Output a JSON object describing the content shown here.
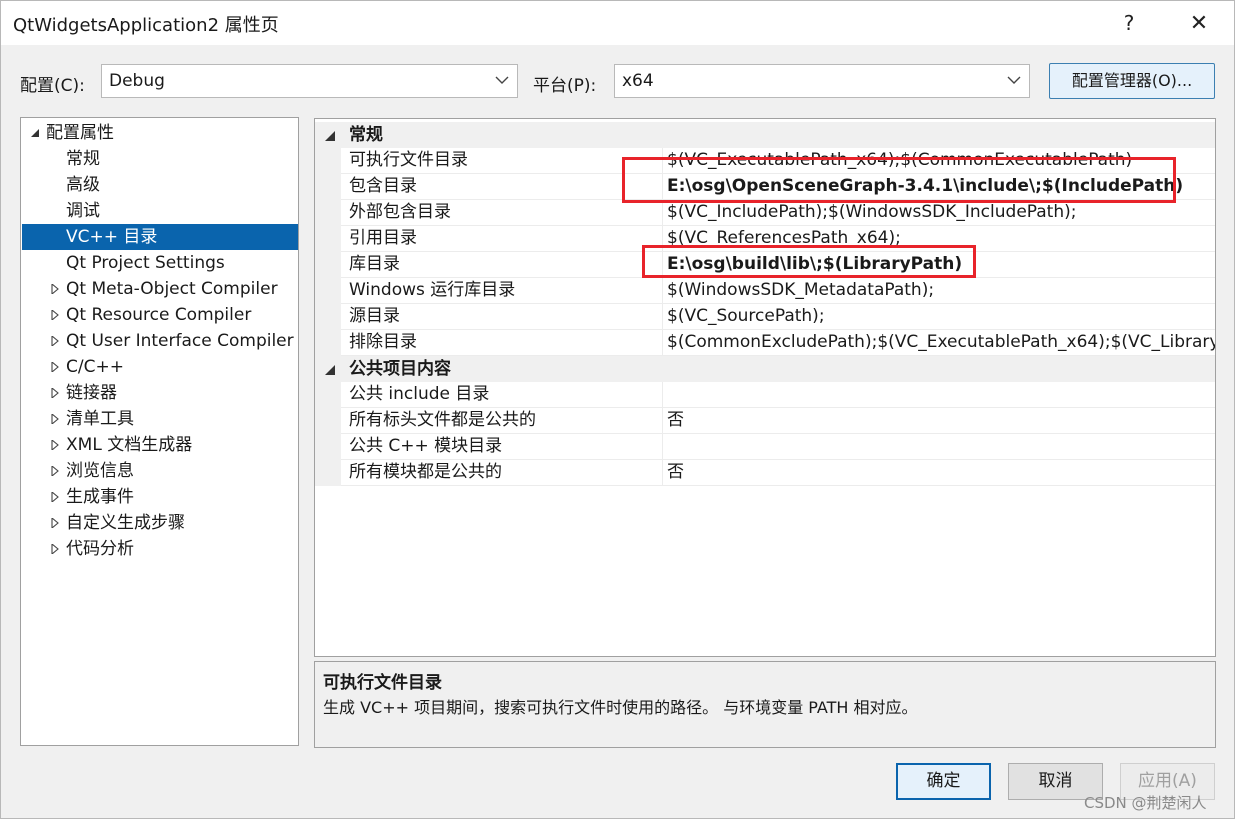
{
  "window": {
    "title": "QtWidgetsApplication2 属性页",
    "help_glyph": "?",
    "close_glyph": "✕"
  },
  "config": {
    "config_label": "配置(C):",
    "config_value": "Debug",
    "platform_label": "平台(P):",
    "platform_value": "x64",
    "manager_button": "配置管理器(O)..."
  },
  "tree": {
    "items": [
      {
        "label": "配置属性",
        "expander": "expanded"
      },
      {
        "label": "常规"
      },
      {
        "label": "高级"
      },
      {
        "label": "调试"
      },
      {
        "label": "VC++ 目录",
        "selected": true
      },
      {
        "label": "Qt Project Settings"
      },
      {
        "label": "Qt Meta-Object Compiler",
        "expander": "collapsed"
      },
      {
        "label": "Qt Resource Compiler",
        "expander": "collapsed"
      },
      {
        "label": "Qt User Interface Compiler",
        "expander": "collapsed"
      },
      {
        "label": "C/C++",
        "expander": "collapsed"
      },
      {
        "label": "链接器",
        "expander": "collapsed"
      },
      {
        "label": "清单工具",
        "expander": "collapsed"
      },
      {
        "label": "XML 文档生成器",
        "expander": "collapsed"
      },
      {
        "label": "浏览信息",
        "expander": "collapsed"
      },
      {
        "label": "生成事件",
        "expander": "collapsed"
      },
      {
        "label": "自定义生成步骤",
        "expander": "collapsed"
      },
      {
        "label": "代码分析",
        "expander": "collapsed"
      }
    ]
  },
  "grid": {
    "category_general": "常规",
    "rows_general": [
      {
        "name": "可执行文件目录",
        "value": "$(VC_ExecutablePath_x64);$(CommonExecutablePath)"
      },
      {
        "name": "包含目录",
        "value": "E:\\osg\\OpenSceneGraph-3.4.1\\include\\;$(IncludePath)",
        "bold": true
      },
      {
        "name": "外部包含目录",
        "value": "$(VC_IncludePath);$(WindowsSDK_IncludePath);"
      },
      {
        "name": "引用目录",
        "value": "$(VC_ReferencesPath_x64);"
      },
      {
        "name": "库目录",
        "value": "E:\\osg\\build\\lib\\;$(LibraryPath)",
        "bold": true
      },
      {
        "name": "Windows 运行库目录",
        "value": "$(WindowsSDK_MetadataPath);"
      },
      {
        "name": "源目录",
        "value": "$(VC_SourcePath);"
      },
      {
        "name": "排除目录",
        "value": "$(CommonExcludePath);$(VC_ExecutablePath_x64);$(VC_Library"
      }
    ],
    "category_public": "公共项目内容",
    "rows_public": [
      {
        "name": "公共 include 目录",
        "value": ""
      },
      {
        "name": "所有标头文件都是公共的",
        "value": "否"
      },
      {
        "name": "公共 C++ 模块目录",
        "value": ""
      },
      {
        "name": "所有模块都是公共的",
        "value": "否"
      }
    ]
  },
  "description": {
    "title": "可执行文件目录",
    "text": "生成 VC++ 项目期间，搜索可执行文件时使用的路径。 与环境变量 PATH 相对应。"
  },
  "buttons": {
    "ok": "确定",
    "cancel": "取消",
    "apply": "应用(A)"
  },
  "watermark": "CSDN @荆楚闲人",
  "colors": {
    "selection": "#0a64ad",
    "highlight_box": "#e8232a"
  }
}
